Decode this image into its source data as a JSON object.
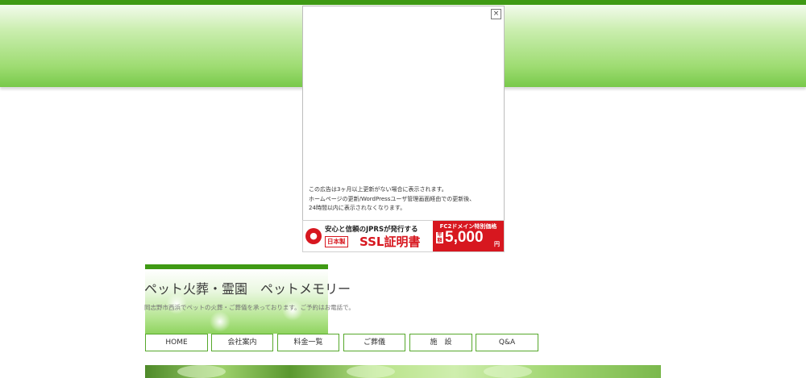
{
  "ad": {
    "close_label": "×",
    "notice_lines": [
      "この広告は3ヶ月以上更新がない場合に表示されます。",
      "ホームページの更新/WordPressユーザ管理画面経由での更新後、",
      "24時間以内に表示されなくなります。"
    ]
  },
  "ssl_banner": {
    "headline": "安心と信頼のJPRSが発行する",
    "made_in_japan": "日本製",
    "title": "SSL証明書",
    "campaign": "FC2ドメイン特別価格",
    "yearly": "年額",
    "price": "5,000",
    "yen": "円"
  },
  "site": {
    "title": "ペット火葬・霊園　ペットメモリー",
    "description": "岡志野市西浜でペットの火葬・ご葬儀を承っております。ご予約はお電話で。"
  },
  "nav": {
    "items": [
      "HOME",
      "会社案内",
      "料金一覧",
      "ご葬儀",
      "施　設",
      "Q&A"
    ]
  },
  "colors": {
    "accent_green": "#3f9a14",
    "header_gradient_light": "#f3fbec",
    "header_gradient_dark": "#78c94a",
    "ssl_red": "#d7171f"
  }
}
